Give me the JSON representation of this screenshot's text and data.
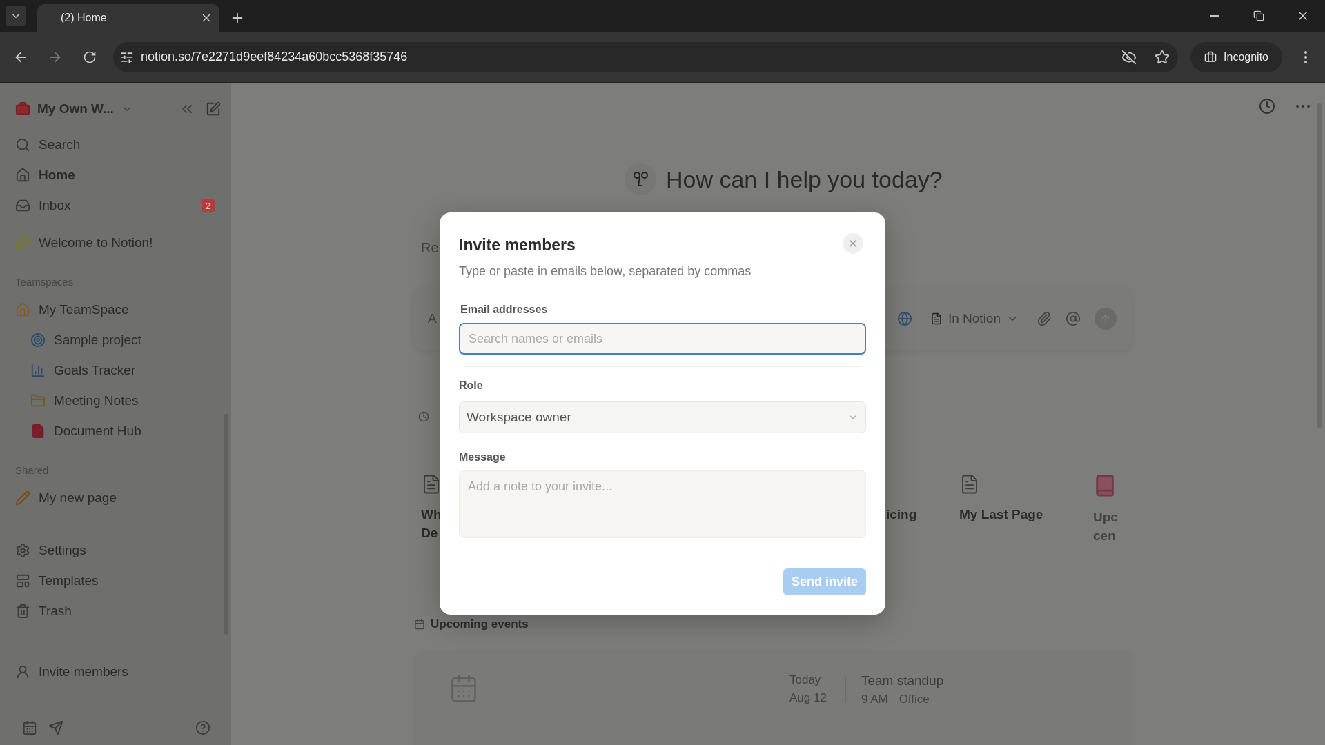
{
  "browser": {
    "tabs": [
      {
        "title": "(2) Home",
        "selected": true
      }
    ],
    "url": "notion.so/7e2271d9eef84234a60bcc5368f35746",
    "profile": "Incognito"
  },
  "sidebar": {
    "workspace": "My Own W...",
    "nav": [
      {
        "label": "Search",
        "selected": false
      },
      {
        "label": "Home",
        "selected": true
      },
      {
        "label": "Inbox",
        "selected": false,
        "badge": "2"
      }
    ],
    "favorites": [
      {
        "label": "Welcome to Notion!"
      }
    ],
    "teamspaces": {
      "heading": "Teamspaces",
      "items": [
        {
          "label": "My TeamSpace",
          "children": [
            {
              "label": "Sample project"
            },
            {
              "label": "Goals Tracker"
            },
            {
              "label": "Meeting Notes"
            },
            {
              "label": "Document Hub"
            }
          ]
        }
      ]
    },
    "shared": {
      "heading": "Shared",
      "items": [
        {
          "label": "My new page"
        }
      ]
    },
    "tools": [
      {
        "label": "Settings"
      },
      {
        "label": "Templates"
      },
      {
        "label": "Trash"
      }
    ],
    "invite": "Invite members"
  },
  "main": {
    "title": "How can I help you today?",
    "fragment": "Re",
    "ask_box": {
      "text": "A",
      "mode": "In Notion"
    },
    "cards": [
      {
        "lines": [
          "Wh",
          "De"
        ]
      },
      {
        "lines": [
          "icing"
        ]
      },
      {
        "lines": [
          "My Last Page"
        ]
      },
      {
        "lines": [
          "Upc",
          "cen"
        ]
      }
    ],
    "events": {
      "heading": "Upcoming events",
      "day": "Today",
      "date": "Aug 12",
      "event": "Team standup",
      "time": "9 AM",
      "place": "Office"
    }
  },
  "modal": {
    "title": "Invite members",
    "subtitle": "Type or paste in emails below, separated by commas",
    "email": {
      "label": "Email addresses",
      "placeholder": "Search names or emails",
      "focused": true
    },
    "role": {
      "label": "Role",
      "value": "Workspace owner"
    },
    "message": {
      "label": "Message",
      "placeholder": "Add a note to your invite..."
    },
    "submit": {
      "label": "Send invite",
      "disabled": true
    }
  }
}
